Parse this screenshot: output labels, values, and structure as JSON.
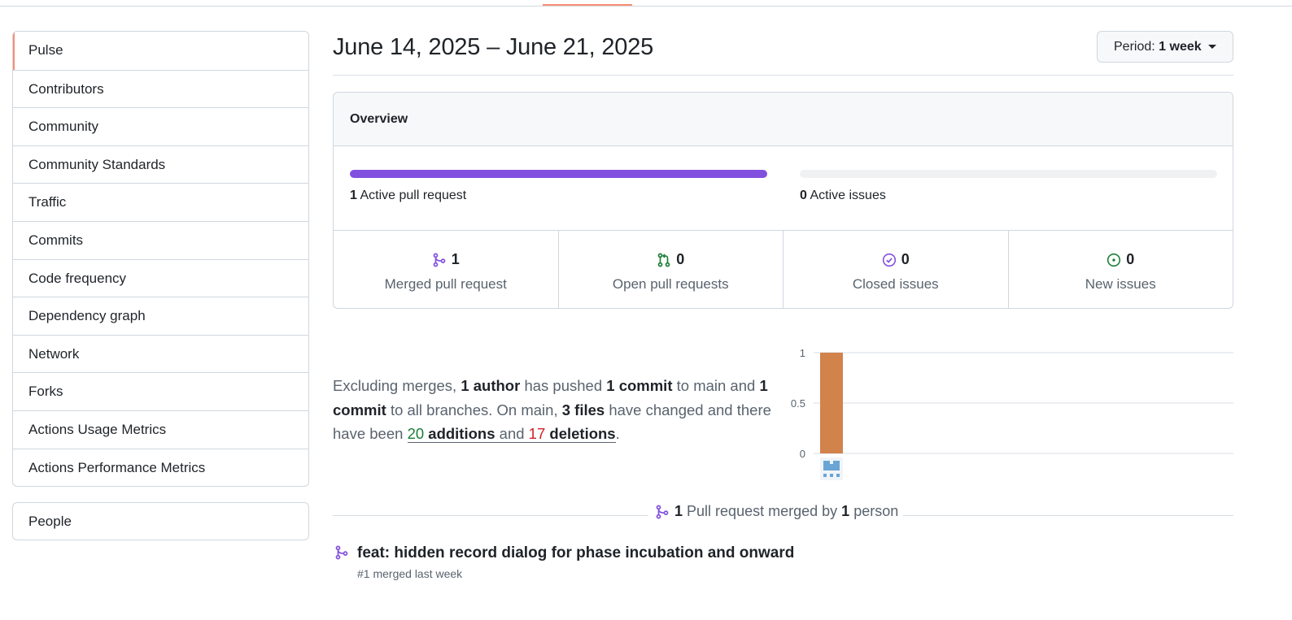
{
  "sidebar": {
    "items": [
      {
        "label": "Pulse"
      },
      {
        "label": "Contributors"
      },
      {
        "label": "Community"
      },
      {
        "label": "Community Standards"
      },
      {
        "label": "Traffic"
      },
      {
        "label": "Commits"
      },
      {
        "label": "Code frequency"
      },
      {
        "label": "Dependency graph"
      },
      {
        "label": "Network"
      },
      {
        "label": "Forks"
      },
      {
        "label": "Actions Usage Metrics"
      },
      {
        "label": "Actions Performance Metrics"
      }
    ],
    "selected": "Pulse",
    "people_label": "People"
  },
  "header": {
    "date_range": "June 14, 2025 – June 21, 2025",
    "period_prefix": "Period:",
    "period_value": "1 week"
  },
  "overview": {
    "title": "Overview",
    "active_prs": {
      "count": "1",
      "label": "Active pull request",
      "fill_fraction": 1.0
    },
    "active_issues": {
      "count": "0",
      "label": "Active issues",
      "fill_fraction": 0.0
    },
    "stats": [
      {
        "count": "1",
        "label": "Merged pull request",
        "icon": "merge-icon",
        "color": "#8250df"
      },
      {
        "count": "0",
        "label": "Open pull requests",
        "icon": "pull-request-icon",
        "color": "#1a7f37"
      },
      {
        "count": "0",
        "label": "Closed issues",
        "icon": "issue-closed-icon",
        "color": "#8250df"
      },
      {
        "count": "0",
        "label": "New issues",
        "icon": "issue-opened-icon",
        "color": "#1a7f37"
      }
    ]
  },
  "summary": {
    "t1": "Excluding merges,",
    "authors": "1 author",
    "t2": "has pushed",
    "commits_main": "1 commit",
    "t3": "to main and",
    "commits_all": "1 commit",
    "t4": "to all branches. On main,",
    "files": "3 files",
    "t5": "have changed and there have been",
    "additions_num": "20",
    "additions_word": "additions",
    "and_word": "and",
    "deletions_num": "17",
    "deletions_word": "deletions",
    "period": "."
  },
  "chart_data": {
    "type": "bar",
    "categories": [
      "contributor-1"
    ],
    "values": [
      1
    ],
    "ylim": [
      0,
      1
    ],
    "yticks": [
      "0",
      "0.5",
      "1"
    ],
    "grid": true,
    "bar_color": "#d2824b"
  },
  "pull_requests": {
    "count": "1",
    "t1": "Pull request merged by",
    "people_count": "1",
    "t2": "person",
    "items": [
      {
        "title": "feat: hidden record dialog for phase incubation and onward",
        "meta": "#1 merged last week"
      }
    ]
  },
  "colors": {
    "accent": "#fd8c73",
    "merged": "#8250df",
    "open": "#1a7f37",
    "deletion": "#cf222e"
  }
}
